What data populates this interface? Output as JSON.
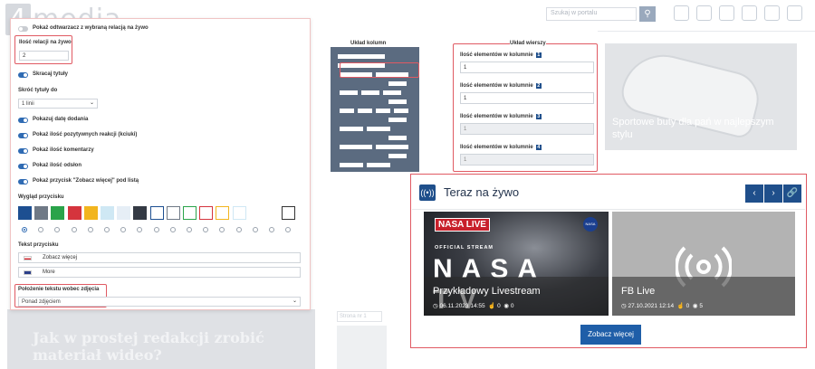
{
  "background_site": {
    "logo_text": "media",
    "search_placeholder": "Szukaj w portalu",
    "card_title": "Sportowe buty dla pań w najlepszym stylu",
    "bottom_headline": "Jak w prostej redakcji zrobić materiał wideo?",
    "pagination": "Strona nr 1"
  },
  "settings": {
    "show_player_label": "Pokaż odtwarzacz z wybraną relacją na żywo",
    "live_count_label": "Ilość relacji na żywo",
    "live_count_value": "2",
    "shorten_titles_label": "Skracaj tytuły",
    "shorten_to_label": "Skróć tytuły do",
    "shorten_to_value": "1 linii",
    "toggles": [
      "Pokazuj datę dodania",
      "Pokaż ilość pozytywnych reakcji (kciuki)",
      "Pokaż ilość komentarzy",
      "Pokaż ilość odsłon",
      "Pokaż przycisk \"Zobacz więcej\" pod listą"
    ],
    "button_look_label": "Wygląd przycisku",
    "swatch_colors": [
      "#1d4f91",
      "#6f7986",
      "#2aa34a",
      "#d5343d",
      "#f2b51e",
      "#cfe8f4",
      "#e6eef6",
      "#343a44"
    ],
    "button_text_label": "Tekst przycisku",
    "button_text_pl": "Zobacz więcej",
    "button_text_en": "More",
    "text_position_label": "Położenie tekstu wobec zdjęcia",
    "text_position_value": "Ponad zdjęciem",
    "column_layout_label": "Układ kolumn",
    "row_layout_label": "Układ wierszy",
    "elements_label": "Ilość elementów w kolumnie",
    "columns": [
      {
        "num": "1",
        "value": "1"
      },
      {
        "num": "2",
        "value": "1"
      },
      {
        "num": "3",
        "value": "1"
      },
      {
        "num": "4",
        "value": "1"
      }
    ]
  },
  "live_widget": {
    "title": "Teraz na żywo",
    "cards": [
      {
        "badge": "NASA LIVE",
        "logo": "NASA",
        "overline": "OFFICIAL STREAM",
        "big_text": "NASA TV",
        "title": "Przykładowy Livestream",
        "date": "06.11.2023 14:55",
        "likes": "0",
        "views": "0"
      },
      {
        "title": "FB Live",
        "date": "27.10.2021 12:14",
        "likes": "0",
        "views": "5"
      }
    ],
    "more_button": "Zobacz więcej"
  },
  "colors": {
    "accent": "#1f5ea8",
    "highlight": "#e05a63",
    "diagram": "#5b6b80"
  }
}
